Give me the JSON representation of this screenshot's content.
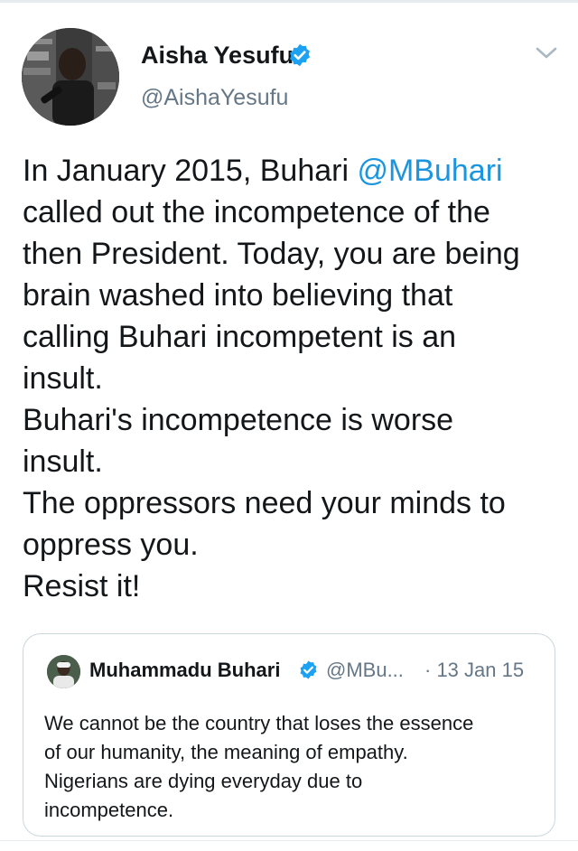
{
  "tweet": {
    "author": {
      "name": "Aisha Yesufu",
      "handle": "@AishaYesufu",
      "verified": true,
      "avatar_icon": "profile-photo-icon"
    },
    "menu_icon": "chevron-down-icon",
    "text": {
      "line1_before_mention": "In January 2015, Buhari ",
      "mention": "@MBuhari",
      "line2": "called out the incompetence of the",
      "line3": "then President. Today, you are being",
      "line4": "brain washed into believing that",
      "line5": "calling Buhari incompetent is an",
      "line6": "insult.",
      "line7": "Buhari's incompetence is worse",
      "line8": "insult.",
      "line9": "The oppressors need your minds to",
      "line10": "oppress you.",
      "line11": "Resist it!"
    }
  },
  "quoted_tweet": {
    "author": {
      "name": "Muhammadu Buhari",
      "handle": "@MBu...",
      "verified": true,
      "avatar_icon": "profile-photo-icon"
    },
    "date": "· 13 Jan 15",
    "text": {
      "line1": "We cannot be the country that loses the essence",
      "line2": "of our humanity, the meaning of empathy.",
      "line3": "Nigerians are dying everyday due to",
      "line4": "incompetence."
    }
  },
  "colors": {
    "link": "#1b95e0",
    "verified": "#1da1f2",
    "secondary_text": "#657786",
    "border": "#ccd6dd"
  }
}
